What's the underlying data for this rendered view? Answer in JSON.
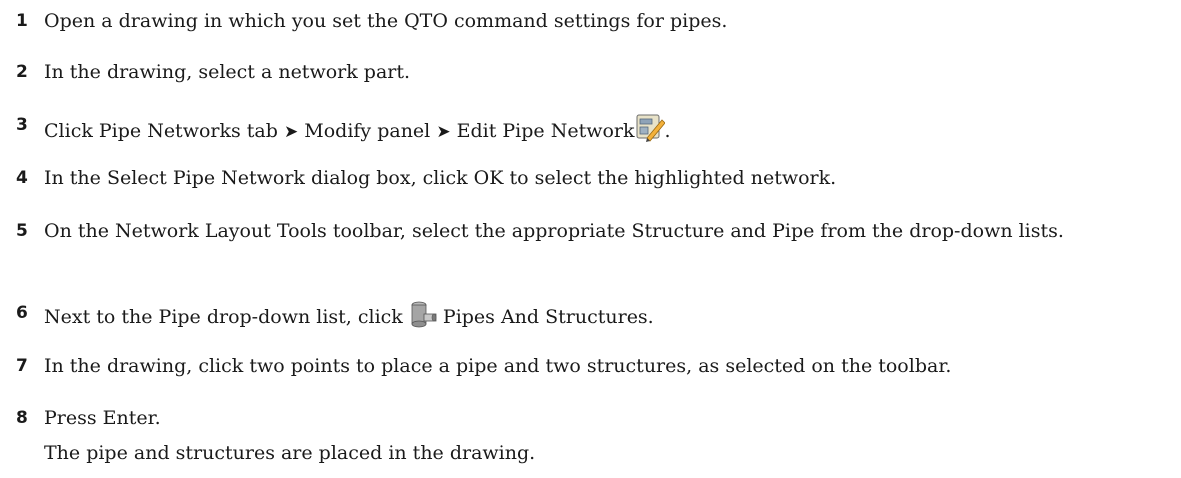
{
  "steps": [
    {
      "number": "1",
      "text": "Open a drawing in which you set the QTO command settings for pipes."
    },
    {
      "number": "2",
      "text": "In the drawing, select a network part."
    },
    {
      "number": "3",
      "part1": "Click Pipe Networks tab",
      "sep1": "➤",
      "part2": "Modify panel",
      "sep2": "➤",
      "part3": "Edit Pipe Network",
      "icon": "edit-pipe-network-icon",
      "end": "."
    },
    {
      "number": "4",
      "text": "In the Select Pipe Network dialog box, click OK to select the highlighted network."
    },
    {
      "number": "5",
      "text": "On the Network Layout Tools toolbar, select the appropriate Structure and Pipe from the drop-down lists."
    },
    {
      "number": "6",
      "before": "Next to the Pipe drop-down list, click",
      "icon": "pipes-and-structures-icon",
      "after": "Pipes And Structures."
    },
    {
      "number": "7",
      "text": "In the drawing, click two points to place a pipe and two structures, as selected on the toolbar."
    },
    {
      "number": "8",
      "text": "Press Enter."
    }
  ],
  "result": "The pipe and structures are placed in the drawing."
}
